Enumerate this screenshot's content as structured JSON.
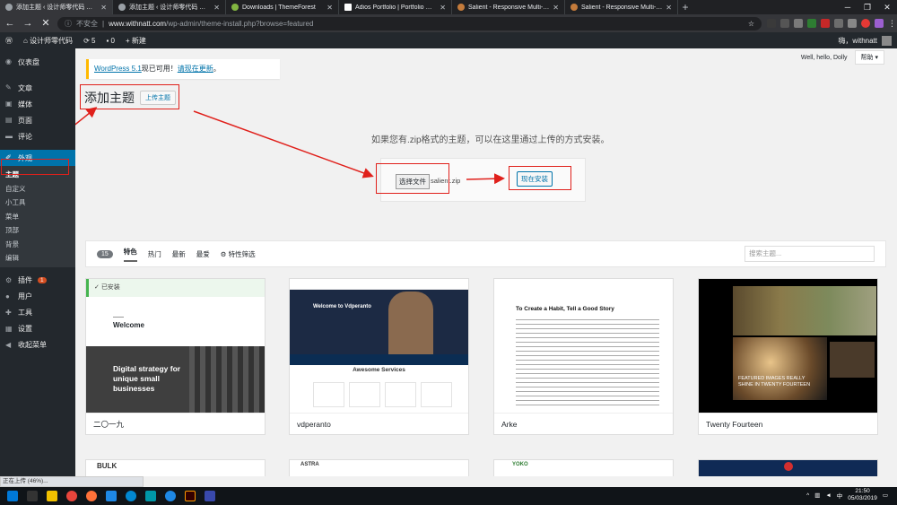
{
  "browser": {
    "tabs": [
      {
        "title": "添加主题 ‹ 设计师零代码 — Wo"
      },
      {
        "title": "添加主题 ‹ 设计师零代码 — Wo"
      },
      {
        "title": "Downloads | ThemeForest"
      },
      {
        "title": "Adios Portfolio | Portfolio WordP"
      },
      {
        "title": "Salient - Responsive Multi-Purpo"
      },
      {
        "title": "Salient - Responsive Multi-Purpo"
      }
    ],
    "new_tab": "+",
    "security": "不安全",
    "url_domain": "www.withnatt.com",
    "url_path": "/wp-admin/theme-install.php?browse=featured"
  },
  "adminbar": {
    "site_name": "设计师零代码",
    "updates": "5",
    "comments": "0",
    "new_label": "新建",
    "greeting": "嗨，withnatt"
  },
  "sidebar": {
    "items": [
      {
        "label": "仪表盘",
        "icon": "dashboard-icon"
      },
      {
        "label": "文章",
        "icon": "pin-icon"
      },
      {
        "label": "媒体",
        "icon": "media-icon"
      },
      {
        "label": "页面",
        "icon": "page-icon"
      },
      {
        "label": "评论",
        "icon": "comment-icon"
      },
      {
        "label": "外观",
        "icon": "brush-icon"
      }
    ],
    "sub": [
      "主题",
      "自定义",
      "小工具",
      "菜单",
      "顶部",
      "背景",
      "编辑"
    ],
    "items2": [
      {
        "label": "插件",
        "icon": "plugin-icon",
        "badge": "1"
      },
      {
        "label": "用户",
        "icon": "user-icon"
      },
      {
        "label": "工具",
        "icon": "tool-icon"
      },
      {
        "label": "设置",
        "icon": "settings-icon"
      },
      {
        "label": "收起菜单",
        "icon": "collapse-icon"
      }
    ]
  },
  "notice": {
    "link": "WordPress 5.1",
    "text": "现已可用！",
    "action": "请现在更新",
    "end": "。"
  },
  "screen": {
    "hello": "Well, hello, Dolly",
    "help": "帮助"
  },
  "page": {
    "title": "添加主题",
    "upload_btn": "上传主题"
  },
  "upload": {
    "instructions": "如果您有.zip格式的主题，可以在这里通过上传的方式安装。",
    "choose_file": "选择文件",
    "file_name": "salient.zip",
    "install": "现在安装"
  },
  "filter": {
    "count": "15",
    "tabs": [
      "特色",
      "热门",
      "最新",
      "最爱"
    ],
    "feature_filter": "特性筛选",
    "search_placeholder": "搜索主题..."
  },
  "themes": [
    {
      "name": "二〇一九",
      "installed": "已安装",
      "shot_title": "Welcome",
      "shot_sub": "Digital strategy for unique small businesses"
    },
    {
      "name": "vdperanto",
      "shot_title": "Welcome to Vdperanto",
      "shot_sub": "Awesome Services"
    },
    {
      "name": "Arke",
      "shot_title": "To Create a Habit, Tell a Good Story"
    },
    {
      "name": "Twenty Fourteen",
      "shot_title": "FEATURED IMAGES REALLY SHINE IN TWENTY FOURTEEN"
    }
  ],
  "row2": {
    "bulk": "BULK",
    "astra": "ASTRA",
    "yoko": "YOKO"
  },
  "status": "正在上传 (46%)...",
  "taskbar": {
    "time": "21:50",
    "date": "05/03/2019",
    "lang": "中"
  }
}
